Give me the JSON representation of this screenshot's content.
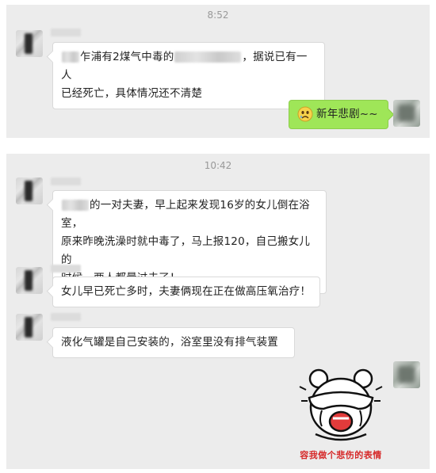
{
  "conversation_1": {
    "timestamp": "8:52",
    "messages": [
      {
        "line1_after_mask1": "乍浦有2煤气中毒的",
        "line1_after_mask2": "，据说已有一人",
        "line2": "已经死亡，具体情况还不清楚"
      }
    ],
    "sent": {
      "emoji": "sad-face-icon",
      "text": "新年悲剧~~"
    }
  },
  "conversation_2": {
    "timestamp": "10:42",
    "messages": [
      {
        "line1": "的一对夫妻，早上起来发现16岁的女儿倒在浴室，",
        "line2": "原来昨晚洗澡时就中毒了，马上报120，自己搬女儿的",
        "line3": "时候，两人都晕过去了！"
      },
      {
        "text": "女儿早已死亡多时，夫妻俩现在正在做高压氧治疗！"
      },
      {
        "text": "液化气罐是自己安装的，浴室里没有排气装置"
      }
    ],
    "sticker": {
      "icon": "crying-bear-sticker",
      "caption": "容我做个悲伤的表情"
    }
  },
  "colors": {
    "panel_bg": "#ececec",
    "sent_bubble": "#9fe658",
    "timestamp": "#999999",
    "sticker_caption": "#d62828"
  }
}
